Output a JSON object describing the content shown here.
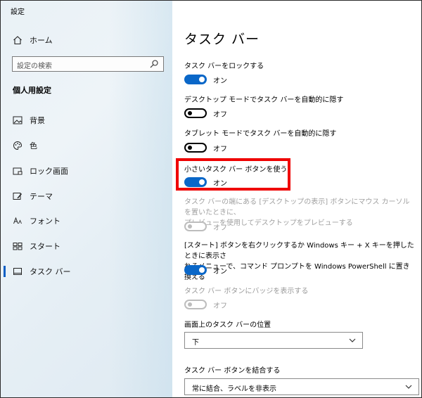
{
  "app": {
    "title": "設定"
  },
  "sidebar": {
    "home_label": "ホーム",
    "search_placeholder": "設定の検索",
    "section_title": "個人用設定",
    "items": [
      {
        "label": "背景",
        "icon": "image-icon"
      },
      {
        "label": "色",
        "icon": "palette-icon"
      },
      {
        "label": "ロック画面",
        "icon": "lock-screen-icon"
      },
      {
        "label": "テーマ",
        "icon": "theme-icon"
      },
      {
        "label": "フォント",
        "icon": "font-icon"
      },
      {
        "label": "スタート",
        "icon": "start-icon"
      },
      {
        "label": "タスク バー",
        "icon": "taskbar-icon",
        "active": true
      }
    ]
  },
  "main": {
    "title": "タスク バー",
    "settings": [
      {
        "label": "タスク バーをロックする",
        "state": "オン",
        "on": true,
        "enabled": true
      },
      {
        "label": "デスクトップ モードでタスク バーを自動的に隠す",
        "state": "オフ",
        "on": false,
        "enabled": true
      },
      {
        "label": "タブレット モードでタスク バーを自動的に隠す",
        "state": "オフ",
        "on": false,
        "enabled": true
      },
      {
        "label": "小さいタスク バー ボタンを使う",
        "state": "オン",
        "on": true,
        "enabled": true
      },
      {
        "label_line1": "タスク バーの端にある [デスクトップの表示] ボタンにマウス カーソルを置いたときに、",
        "label_line2": "プレビューを使用してデスクトップをプレビューする",
        "state": "オフ",
        "on": false,
        "enabled": false
      },
      {
        "label_line1": "[スタート] ボタンを右クリックするか Windows キー + X キーを押したときに表示さ",
        "label_line2": "れるメニューで、コマンド プロンプトを Windows PowerShell に置き換える",
        "state": "オン",
        "on": true,
        "enabled": true
      },
      {
        "label": "タスク バー ボタンにバッジを表示する",
        "state": "オフ",
        "on": false,
        "enabled": false
      }
    ],
    "position": {
      "label": "画面上のタスク バーの位置",
      "value": "下"
    },
    "combine": {
      "label": "タスク バー ボタンを結合する",
      "value": "常に結合、ラベルを非表示"
    }
  },
  "colors": {
    "accent": "#0a67c8",
    "highlight": "#ef0000"
  }
}
